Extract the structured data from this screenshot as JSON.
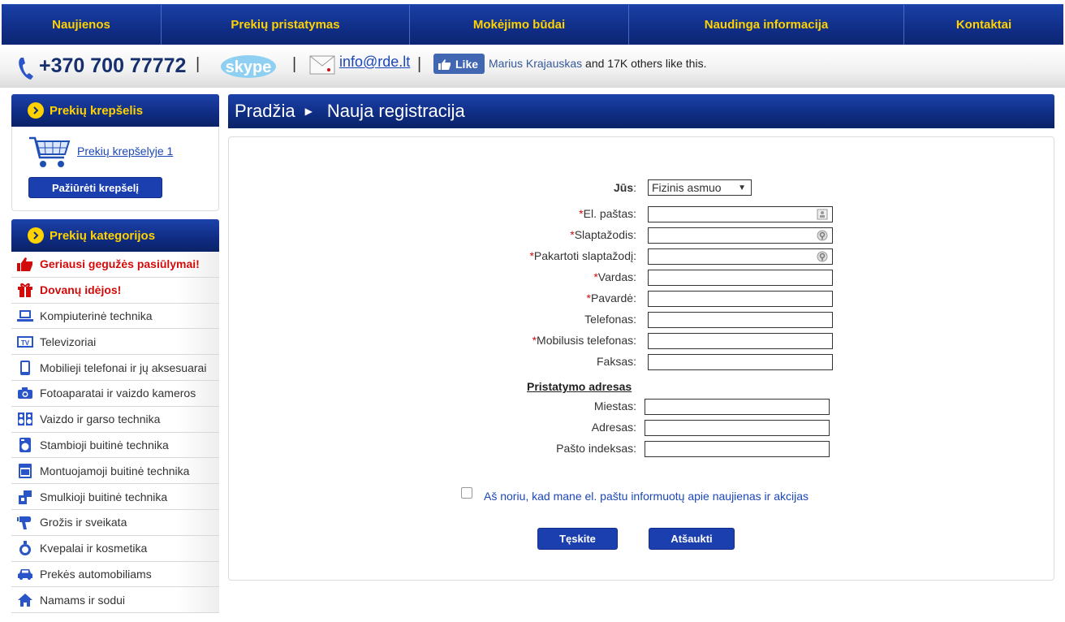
{
  "nav": {
    "items": [
      "Naujienos",
      "Prekių pristatymas",
      "Mokėjimo būdai",
      "Naudinga informacija",
      "Kontaktai"
    ]
  },
  "info": {
    "phone": "+370 700 77772",
    "email": "info@rde.lt",
    "fb_like": "Like",
    "fb_name": "Marius Krajauskas",
    "fb_rest": " and 17K others like this."
  },
  "cart": {
    "title": "Prekių krepšelis",
    "link": "Prekių krepšelyje 1",
    "button": "Pažiūrėti krepšelį"
  },
  "categories": {
    "title": "Prekių kategorijos",
    "items": [
      {
        "label": "Geriausi gegužės pasiūlymai!",
        "icon": "thumbs-up-icon",
        "hot": true
      },
      {
        "label": "Dovanų idėjos!",
        "icon": "gift-icon",
        "hot": true
      },
      {
        "label": "Kompiuterinė technika",
        "icon": "laptop-icon",
        "hot": false
      },
      {
        "label": "Televizoriai",
        "icon": "tv-icon",
        "hot": false
      },
      {
        "label": "Mobilieji telefonai ir jų aksesuarai",
        "icon": "mobile-icon",
        "hot": false
      },
      {
        "label": "Fotoaparatai ir vaizdo kameros",
        "icon": "camera-icon",
        "hot": false
      },
      {
        "label": "Vaizdo ir garso technika",
        "icon": "speakers-icon",
        "hot": false
      },
      {
        "label": "Stambioji buitinė technika",
        "icon": "washer-icon",
        "hot": false
      },
      {
        "label": "Montuojamoji buitinė technika",
        "icon": "oven-icon",
        "hot": false
      },
      {
        "label": "Smulkioji buitinė technika",
        "icon": "appliance-icon",
        "hot": false
      },
      {
        "label": "Grožis ir sveikata",
        "icon": "hairdryer-icon",
        "hot": false
      },
      {
        "label": "Kvepalai ir kosmetika",
        "icon": "perfume-icon",
        "hot": false
      },
      {
        "label": "Prekės automobiliams",
        "icon": "car-icon",
        "hot": false
      },
      {
        "label": "Namams ir sodui",
        "icon": "house-icon",
        "hot": false
      }
    ]
  },
  "breadcrumb": {
    "home": "Pradžia",
    "current": "Nauja registracija"
  },
  "form": {
    "type_label": "Jūs",
    "type_value": "Fizinis asmuo",
    "fields": [
      {
        "label": "El. paštas",
        "required": true
      },
      {
        "label": "Slaptažodis",
        "required": true
      },
      {
        "label": "Pakartoti slaptažodį",
        "required": true
      },
      {
        "label": "Vardas",
        "required": true
      },
      {
        "label": "Pavardė",
        "required": true
      },
      {
        "label": "Telefonas",
        "required": false
      },
      {
        "label": "Mobilusis telefonas",
        "required": true
      },
      {
        "label": "Faksas",
        "required": false
      }
    ],
    "address_title": "Pristatymo adresas",
    "address_fields": [
      "Miestas",
      "Adresas",
      "Pašto indeksas"
    ],
    "newsletter": "Aš noriu, kad mane el. paštu informuotų apie naujienas ir akcijas",
    "submit": "Tęskite",
    "cancel": "Atšaukti"
  },
  "colors": {
    "nav_bg": "#102e86",
    "nav_text": "#ffd200",
    "link": "#1c47b8",
    "hot": "#d10a0a"
  }
}
